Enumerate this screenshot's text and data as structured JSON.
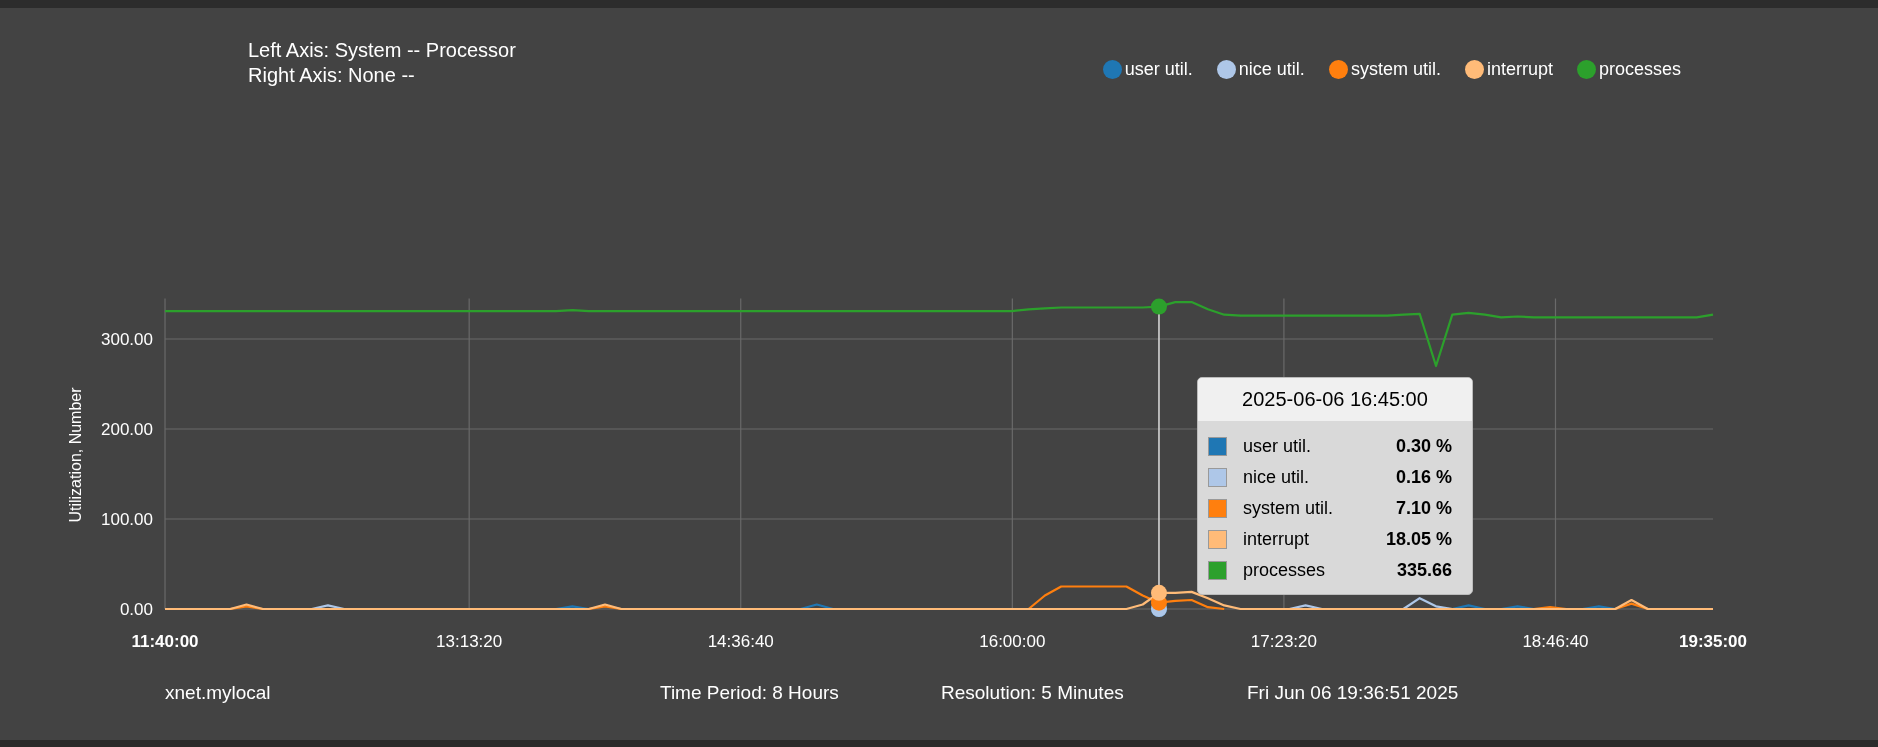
{
  "header": {
    "left_axis": "Left Axis: System -- Processor",
    "right_axis": "Right Axis: None --"
  },
  "chart_data": {
    "type": "line",
    "ylabel": "Utilization, Number",
    "ylim": [
      0,
      345
    ],
    "xlim": [
      42000,
      70500
    ],
    "grid": true,
    "x": [
      42000,
      42300,
      42600,
      42900,
      43200,
      43500,
      43800,
      44100,
      44400,
      44700,
      45000,
      45300,
      45600,
      45900,
      46200,
      46500,
      46800,
      47100,
      47400,
      47700,
      48000,
      48300,
      48600,
      48900,
      49200,
      49500,
      49800,
      50100,
      50400,
      50700,
      51000,
      51300,
      51600,
      51900,
      52200,
      52500,
      52800,
      53100,
      53400,
      53700,
      54000,
      54300,
      54600,
      54900,
      55200,
      55500,
      55800,
      56100,
      56400,
      56700,
      57000,
      57300,
      57600,
      57900,
      58200,
      58500,
      58800,
      59100,
      59400,
      59700,
      60000,
      60300,
      60600,
      60900,
      61200,
      61500,
      61800,
      62100,
      62400,
      62700,
      63000,
      63300,
      63600,
      63900,
      64200,
      64500,
      64800,
      65100,
      65400,
      65700,
      66000,
      66300,
      66600,
      66900,
      67200,
      67500,
      67800,
      68100,
      68400,
      68700,
      69000,
      69300,
      69600,
      69900,
      70200,
      70500
    ],
    "xticks": [
      {
        "value": 42000,
        "label": "11:40:00"
      },
      {
        "value": 47600,
        "label": "13:13:20"
      },
      {
        "value": 52600,
        "label": "14:36:40"
      },
      {
        "value": 57600,
        "label": "16:00:00"
      },
      {
        "value": 62600,
        "label": "17:23:20"
      },
      {
        "value": 67600,
        "label": "18:46:40"
      },
      {
        "value": 70500,
        "label": "19:35:00"
      }
    ],
    "yticks": [
      {
        "value": 0,
        "label": "0.00"
      },
      {
        "value": 100,
        "label": "100.00"
      },
      {
        "value": 200,
        "label": "200.00"
      },
      {
        "value": 300,
        "label": "300.00"
      }
    ],
    "series": [
      {
        "name": "user util.",
        "color": "#1f77b4",
        "values": [
          null,
          null,
          null,
          null,
          null,
          null,
          null,
          null,
          null,
          null,
          null,
          null,
          null,
          null,
          null,
          null,
          null,
          null,
          null,
          null,
          null,
          null,
          null,
          null,
          0,
          3,
          0,
          null,
          null,
          null,
          null,
          null,
          null,
          null,
          null,
          null,
          null,
          null,
          null,
          0,
          5,
          0,
          null,
          null,
          null,
          null,
          null,
          null,
          null,
          null,
          null,
          null,
          null,
          null,
          null,
          null,
          null,
          null,
          null,
          null,
          null,
          null,
          null,
          null,
          null,
          null,
          null,
          null,
          null,
          null,
          null,
          null,
          null,
          null,
          null,
          null,
          null,
          null,
          null,
          0,
          4,
          0,
          0,
          3,
          0,
          null,
          null,
          0,
          3,
          0,
          null,
          null,
          null,
          null,
          null,
          null
        ]
      },
      {
        "name": "nice util.",
        "color": "#aec7e8",
        "values": [
          null,
          null,
          null,
          null,
          null,
          null,
          null,
          null,
          null,
          0,
          4,
          0,
          null,
          null,
          null,
          null,
          null,
          null,
          null,
          null,
          null,
          null,
          null,
          null,
          null,
          null,
          null,
          null,
          null,
          null,
          null,
          null,
          null,
          null,
          null,
          null,
          null,
          null,
          null,
          null,
          null,
          null,
          null,
          null,
          null,
          null,
          null,
          null,
          null,
          null,
          null,
          null,
          null,
          null,
          null,
          null,
          null,
          null,
          null,
          null,
          null,
          null,
          null,
          null,
          null,
          null,
          null,
          null,
          null,
          0,
          4,
          0,
          null,
          null,
          null,
          null,
          0,
          12,
          3,
          0,
          null,
          null,
          null,
          null,
          null,
          null,
          null,
          null,
          null,
          null,
          null,
          null,
          null,
          null,
          null,
          null
        ]
      },
      {
        "name": "system util.",
        "color": "#ff7f0e",
        "values": [
          null,
          null,
          null,
          null,
          0,
          3,
          0,
          null,
          null,
          null,
          null,
          null,
          null,
          null,
          null,
          null,
          null,
          null,
          null,
          null,
          null,
          null,
          null,
          null,
          null,
          null,
          0,
          3,
          0,
          null,
          null,
          null,
          null,
          null,
          null,
          null,
          null,
          null,
          null,
          null,
          null,
          null,
          null,
          null,
          null,
          null,
          null,
          null,
          null,
          null,
          null,
          null,
          null,
          0,
          15,
          25,
          25,
          25,
          25,
          25,
          15,
          7,
          9,
          10,
          2,
          0,
          null,
          null,
          null,
          null,
          null,
          null,
          null,
          null,
          null,
          null,
          null,
          null,
          null,
          null,
          null,
          null,
          null,
          null,
          0,
          2,
          0,
          null,
          null,
          0,
          6,
          0,
          null,
          null,
          null,
          null
        ]
      },
      {
        "name": "interrupt",
        "color": "#ffbb78",
        "values": [
          0,
          0,
          0,
          0,
          0,
          5,
          0,
          0,
          0,
          0,
          0,
          0,
          0,
          0,
          0,
          0,
          0,
          0,
          0,
          0,
          0,
          0,
          0,
          0,
          0,
          0,
          0,
          5,
          0,
          0,
          0,
          0,
          0,
          0,
          0,
          0,
          0,
          0,
          0,
          0,
          0,
          0,
          0,
          0,
          0,
          0,
          0,
          0,
          0,
          0,
          0,
          0,
          0,
          0,
          0,
          0,
          0,
          0,
          0,
          0,
          5,
          18,
          18,
          19,
          12,
          4,
          0,
          0,
          0,
          0,
          0,
          0,
          0,
          0,
          0,
          0,
          0,
          0,
          0,
          0,
          0,
          0,
          0,
          0,
          0,
          0,
          0,
          0,
          0,
          0,
          10,
          0,
          0,
          0,
          0,
          0
        ]
      },
      {
        "name": "processes",
        "color": "#2ca02c",
        "values": [
          331,
          331,
          331,
          331,
          331,
          331,
          331,
          331,
          331,
          331,
          331,
          331,
          331,
          331,
          331,
          331,
          331,
          331,
          331,
          331,
          331,
          331,
          331,
          331,
          331,
          332,
          331,
          331,
          331,
          331,
          331,
          331,
          331,
          331,
          331,
          331,
          331,
          331,
          331,
          331,
          331,
          331,
          331,
          331,
          331,
          331,
          331,
          331,
          331,
          331,
          331,
          331,
          331,
          333,
          334,
          335,
          335,
          335,
          335,
          335,
          335,
          336,
          341,
          341,
          333,
          327,
          326,
          326,
          326,
          326,
          326,
          326,
          326,
          326,
          326,
          326,
          327,
          328,
          270,
          327,
          329,
          327,
          324,
          325,
          324,
          324,
          324,
          324,
          324,
          324,
          324,
          324,
          324,
          324,
          324,
          327
        ]
      }
    ],
    "ref_lines": [
      {
        "axis": "x",
        "value": 60300,
        "color": "#dddddd"
      }
    ]
  },
  "tooltip": {
    "title": "2025-06-06 16:45:00",
    "items": [
      {
        "label": "user util.",
        "value": "0.30 %",
        "color": "#1f77b4"
      },
      {
        "label": "nice util.",
        "value": "0.16 %",
        "color": "#aec7e8"
      },
      {
        "label": "system util.",
        "value": "7.10 %",
        "color": "#ff7f0e"
      },
      {
        "label": "interrupt",
        "value": "18.05 %",
        "color": "#ffbb78"
      },
      {
        "label": "processes",
        "value": "335.66",
        "color": "#2ca02c"
      }
    ]
  },
  "footer": {
    "host": "xnet.mylocal",
    "time_period": "Time Period: 8 Hours",
    "resolution": "Resolution: 5 Minutes",
    "timestamp": "Fri Jun 06 19:36:51 2025"
  }
}
